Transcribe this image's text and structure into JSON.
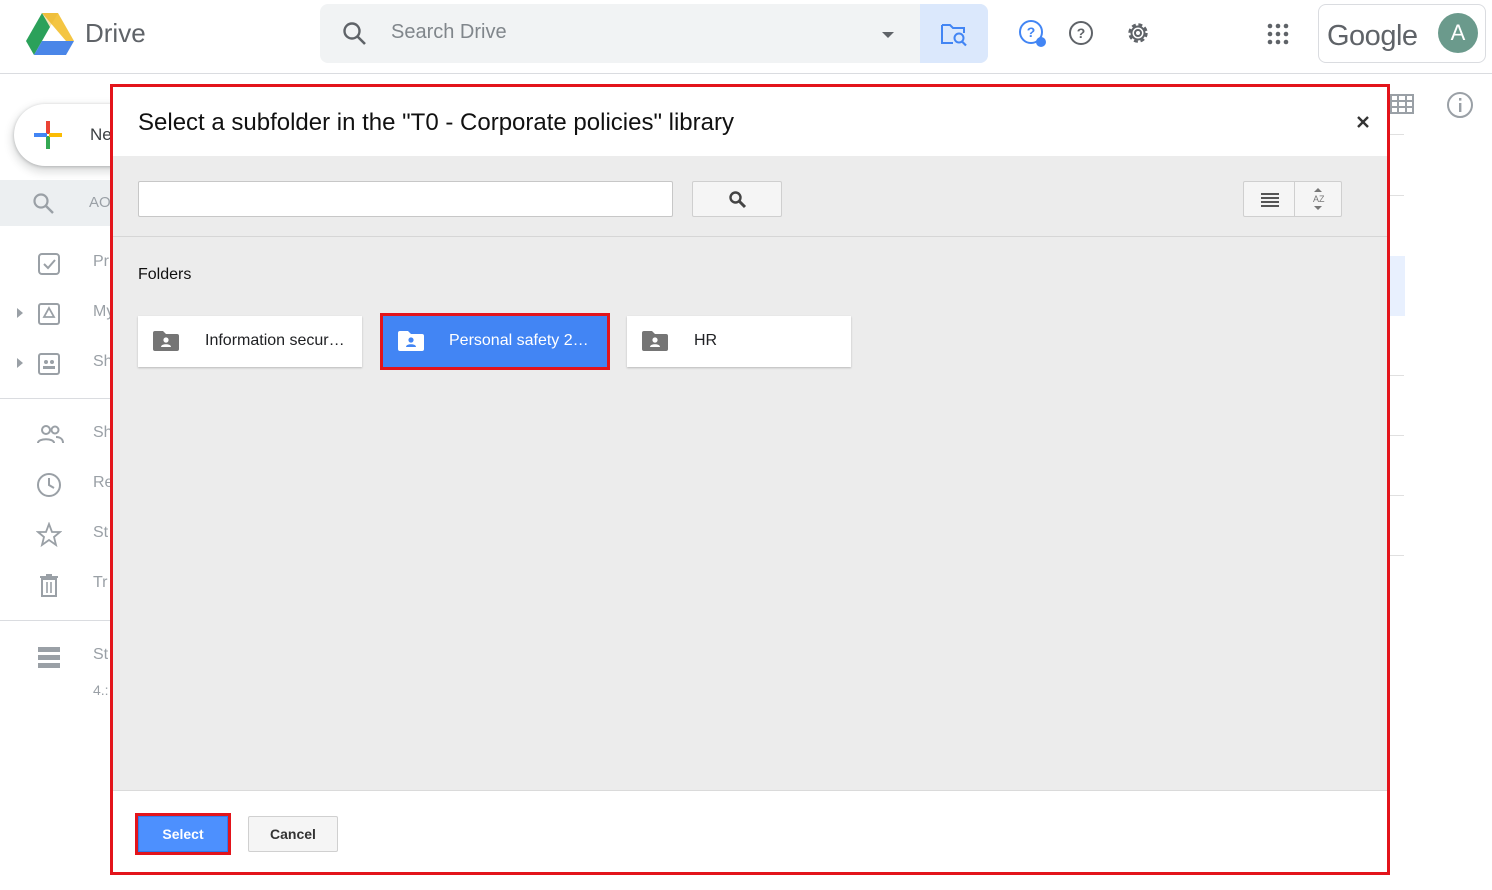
{
  "app": {
    "name": "Drive",
    "account_wordmark": "Google",
    "avatar_letter": "A"
  },
  "search": {
    "placeholder": "Search Drive"
  },
  "icons": {
    "search": "search-icon",
    "options": "caret-down-icon",
    "advanced": "folder-search-icon",
    "support": "support-icon",
    "help": "help-icon",
    "settings": "gear-icon",
    "apps": "apps-grid-icon"
  },
  "sidebar": {
    "new_label": "Ne",
    "search_row": "AO",
    "items": [
      {
        "label": "Pr",
        "icon": "checkbox-icon"
      },
      {
        "label": "My",
        "icon": "my-drive-icon"
      },
      {
        "label": "Sh",
        "icon": "shared-drives-icon"
      },
      {
        "label": "Sh",
        "icon": "shared-with-me-icon"
      },
      {
        "label": "Re",
        "icon": "clock-icon"
      },
      {
        "label": "St",
        "icon": "star-icon"
      },
      {
        "label": "Tr",
        "icon": "trash-icon"
      },
      {
        "label": "St",
        "icon": "storage-icon"
      }
    ],
    "storage_value": "4.:"
  },
  "dialog": {
    "title": "Select a subfolder in the \"T0 - Corporate policies\" library",
    "search_value": "",
    "folders_heading": "Folders",
    "folders": [
      {
        "label": "Information secur…",
        "selected": false
      },
      {
        "label": "Personal safety 2…",
        "selected": true
      },
      {
        "label": "HR",
        "selected": false
      }
    ],
    "select_label": "Select",
    "cancel_label": "Cancel"
  },
  "colors": {
    "accent": "#4285f4",
    "highlight": "#e3141b",
    "select_button": "#4d90fe"
  }
}
